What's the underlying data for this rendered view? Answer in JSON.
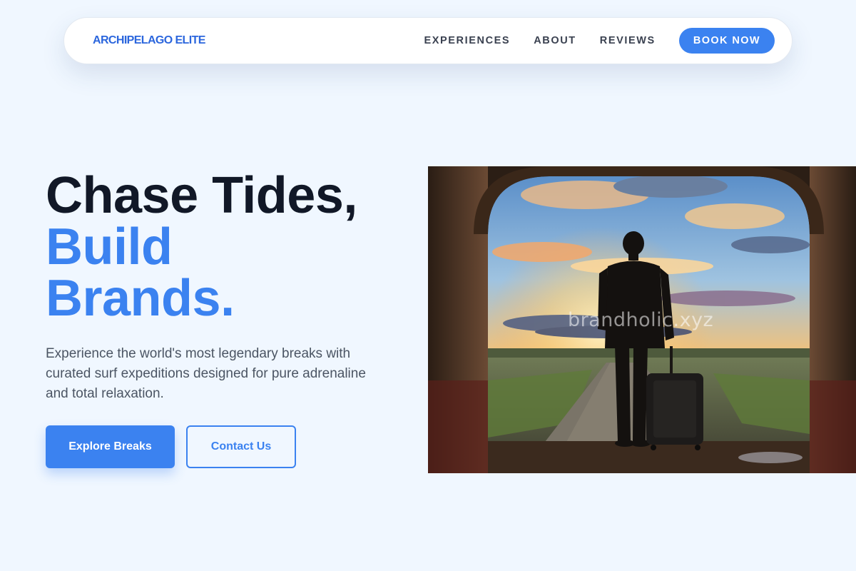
{
  "nav": {
    "brand": "ARCHIPELAGO ELITE",
    "links": [
      "EXPERIENCES",
      "ABOUT",
      "REVIEWS"
    ],
    "cta": "BOOK NOW"
  },
  "hero": {
    "title_line1": "Chase Tides,",
    "title_line2": "Build",
    "title_line3": "Brands.",
    "description": "Experience the world's most legendary breaks with curated surf expeditions designed for pure adrenaline and total relaxation.",
    "primary_button": "Explore Breaks",
    "secondary_button": "Contact Us",
    "image_watermark": "brandholic.xyz"
  },
  "colors": {
    "accent": "#3b82f0",
    "brand_text": "#2b66dd",
    "heading": "#111827",
    "body_text": "#4b5563",
    "page_background": "#f0f7ff"
  }
}
